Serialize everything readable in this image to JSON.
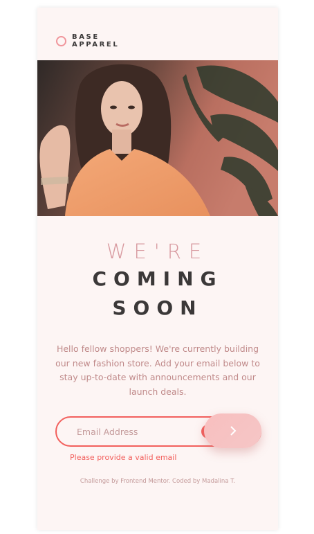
{
  "brand": {
    "line1": "BASE",
    "line2": "APPAREL",
    "accent_color": "#f0959b"
  },
  "hero": {
    "image_alt": "woman-in-peach-shirt-photo"
  },
  "headline": {
    "line1": "WE'RE",
    "line2": "COMING",
    "line3": "SOON"
  },
  "description": "Hello fellow shoppers! We're currently building our new fashion store. Add your email below to stay up-to-date with announcements and our launch deals.",
  "form": {
    "email_placeholder": "Email Address",
    "email_value": "",
    "error_icon_glyph": "!",
    "error_message": "Please provide a valid email",
    "submit_icon": "chevron-right-icon",
    "error_color": "#f25f5c"
  },
  "footer": {
    "credit": "Challenge by Frontend Mentor. Coded by Madalina T."
  }
}
